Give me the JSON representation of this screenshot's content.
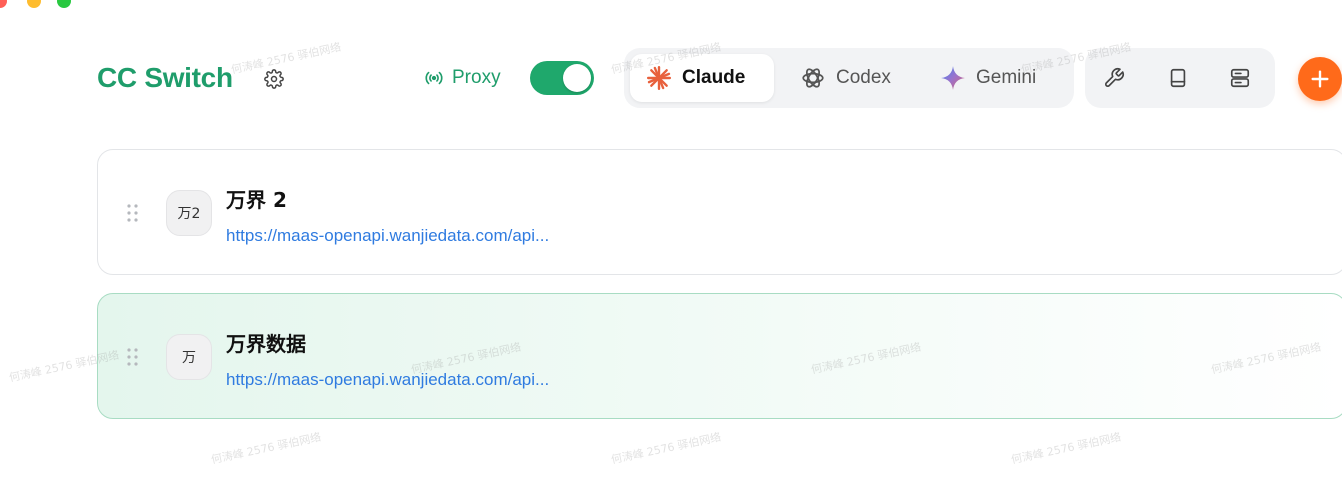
{
  "header": {
    "app_title": "CC Switch",
    "proxy_label": "Proxy",
    "proxy_enabled": true
  },
  "app_tabs": [
    {
      "label": "Claude",
      "icon": "claude-icon",
      "active": true,
      "color": "#e8603c"
    },
    {
      "label": "Codex",
      "icon": "codex-icon",
      "active": false
    },
    {
      "label": "Gemini",
      "icon": "gemini-icon",
      "active": false
    }
  ],
  "toolbar": {
    "icons": [
      "wrench-icon",
      "book-icon",
      "server-icon"
    ],
    "add_icon": "plus-icon"
  },
  "providers": [
    {
      "avatar_text": "万2",
      "name": "万界 2",
      "url": "https://maas-openapi.wanjiedata.com/api...",
      "active": false
    },
    {
      "avatar_text": "万",
      "name": "万界数据",
      "url": "https://maas-openapi.wanjiedata.com/api...",
      "active": true
    }
  ],
  "watermark": "何涛峰 2576 驿伯网络",
  "colors": {
    "brand": "#1f9d6b",
    "toggle_on": "#1fa86c",
    "add_button": "#ff6a1a",
    "link": "#2f7be0"
  }
}
